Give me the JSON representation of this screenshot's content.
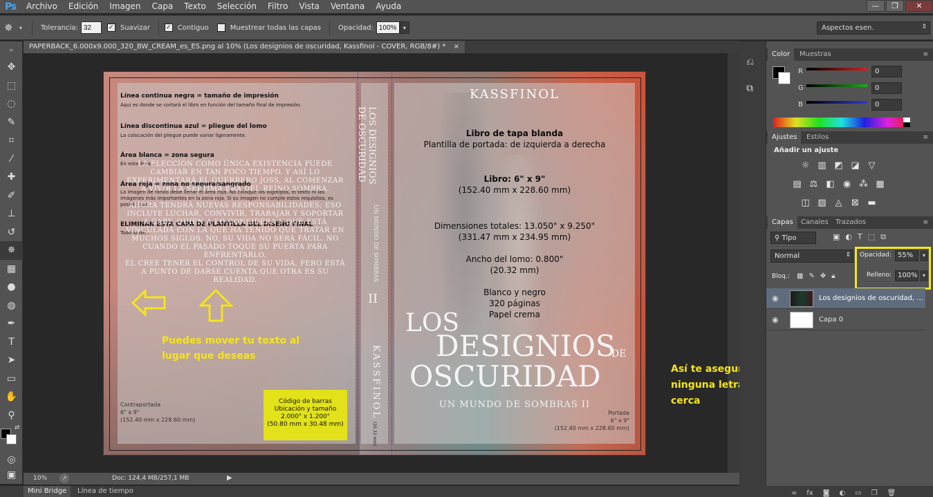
{
  "app": {
    "logo": "Ps"
  },
  "menu": [
    "Archivo",
    "Edición",
    "Imagen",
    "Capa",
    "Texto",
    "Selección",
    "Filtro",
    "Vista",
    "Ventana",
    "Ayuda"
  ],
  "window_controls": {
    "minimize": "—",
    "restore": "❐",
    "close": "✕"
  },
  "options": {
    "tolerance_label": "Tolerancia:",
    "tolerance_value": "32",
    "smooth_label": "Suavizar",
    "contiguous_label": "Contiguo",
    "sample_all_label": "Muestrear todas las capas",
    "opacity_label": "Opacidad:",
    "opacity_value": "100%",
    "workspace": "Aspectos esen."
  },
  "tools": [
    "move-icon",
    "marquee-icon",
    "lasso-icon",
    "quick-select-icon",
    "crop-icon",
    "eyedropper-icon",
    "healing-icon",
    "brush-icon",
    "stamp-icon",
    "history-brush-icon",
    "eraser-icon",
    "gradient-icon",
    "blur-icon",
    "dodge-icon",
    "pen-icon",
    "type-icon",
    "path-select-icon",
    "shape-icon",
    "hand-icon",
    "zoom-icon"
  ],
  "document": {
    "tab_title": "PAPERBACK_6.000x9.000_320_BW_CREAM_es_ES.png al 10% (Los designios de oscuridad, Kassfinol - COVER, RGB/8#) *",
    "close": "×",
    "template": {
      "h1": "Línea continua negra = tamaño de impresión",
      "p1": "Aquí es donde se cortará el libro en función del tamaño final de impresión.",
      "h2": "Línea discontinua azul = pliegue del lomo",
      "p2": "La colocación del pliegue puede variar ligeramente.",
      "h3": "Área blanca = zona segura",
      "p3": "En esta área...",
      "h4": "Área roja = zona no segura/sangrado",
      "p4": "La imagen de fondo debe llenar el área roja. No coloque los logotipos, el texto ni las imágenes más importantes en la zona roja. Si su imagen no cumple estos requisitos, es posible que...",
      "h5": "ELIMINAR ESTA CAPA DE PLANTILLA DEL DISEÑO FINAL",
      "p5": "Todo lo de...",
      "back_label": "Contraportada",
      "back_size": "6\" x 9\"",
      "back_mm": "(152.40 mm x 228.60 mm)",
      "front_label": "Portada",
      "front_size": "6\" x 9\"",
      "front_mm": "(152.40 mm x 228.60 mm)",
      "barcode": [
        "Código de barras",
        "Ubicación y tamaño",
        "2.000\" x 1.200\"",
        "(50.80 mm x 30.48 mm)"
      ],
      "spine_mm": "(20.32 mm)",
      "center": {
        "l1": "Libro de tapa blanda",
        "l2": "Plantilla de portada: de izquierda a derecha",
        "l3": "Libro: 6\" x 9\"",
        "l4": "(152.40 mm x 228.60 mm)",
        "l5": "Dimensiones totales: 13.050\" x 9.250\"",
        "l6": "(331.47 mm x 234.95 mm)",
        "l7": "Ancho del lomo: 0.800\"",
        "l8": "(20.32 mm)",
        "l9": "Blanco y negro",
        "l10": "320 páginas",
        "l11": "Papel crema"
      }
    },
    "synopsis": {
      "s1": "LA ELECCIÓN COMO ÚNICA EXISTENCIA PUEDE CAMBIAR EN TAN POCO TIEMPO. Y ASÍ LO EXPERIMENTARÁ EL GUERRERO JOSS, AL COMENZAR A VIVIR LA SÉPTIMA ERA DEL REINO SOMBRA.",
      "s2": "AHORA TENDRÁ NUEVAS RESPONSABILIDADES; ESO INCLUYE LUCHAR, CONVIVIR, TRABAJAR Y SOPORTAR A GABY, QUIEN A LO CONSIDERA Y QUE ESTÁ VINCULADA CON LA QUE HA TENIDO QUE TRATAR EN MUCHOS SIGLOS. NO, SU VIDA NO SERÁ FÁCIL. NO CUANDO EL PASADO TOQUE SU PUERTA PARA ENFRENTARLO.",
      "s3": "ÉL CREE TENER EL CONTROL DE SU VIDA, PERO ESTÁ A PUNTO DE DARSE CUENTA QUE OTRA ES SU REALIDAD."
    },
    "cover": {
      "author": "KASSFINOL",
      "title_los": "LOS",
      "title_designios": "DESIGNIOS",
      "title_de": "DE",
      "title_oscuridad": "OSCURIDAD",
      "subtitle": "UN MUNDO DE SOMBRAS II"
    },
    "spine": {
      "title1": "LOS DESIGNIOS",
      "title2": "DE OSCURIDAD",
      "subtitle": "UN MUNDO DE SOMBRAS",
      "num": "II",
      "author": "KASSFINOL"
    },
    "annotations": {
      "move_note": "Puedes mover tu texto al lugar que deseas",
      "right_note": "Así te aseguras que todo quede perfecto y ninguna letra se corte porque nada está cerca"
    }
  },
  "status": {
    "zoom": "10%",
    "doc": "Doc: 124,4 MB/257,1 MB"
  },
  "bottom_tabs": [
    "Mini Bridge",
    "Línea de tiempo"
  ],
  "panels": {
    "color_tabs": [
      "Color",
      "Muestras"
    ],
    "rgb": [
      {
        "ch": "R",
        "value": "0",
        "color": "#d42020"
      },
      {
        "ch": "G",
        "value": "0",
        "color": "#1cae1c"
      },
      {
        "ch": "B",
        "value": "0",
        "color": "#2a3ad8"
      }
    ],
    "adjust_tabs": [
      "Ajustes",
      "Estilos"
    ],
    "add_adjustment": "Añadir un ajuste",
    "layers_tabs": [
      "Capas",
      "Canales",
      "Trazados"
    ],
    "filter_kind": "Tipo",
    "blend_mode": "Normal",
    "opacity_label": "Opacidad:",
    "opacity_value": "55%",
    "lock_label": "Bloq.:",
    "fill_label": "Relleno:",
    "fill_value": "100%",
    "layers": [
      {
        "name": "Los designios de oscuridad, ..."
      },
      {
        "name": "Capa 0"
      }
    ]
  },
  "highlight_color": "#f5e51a"
}
